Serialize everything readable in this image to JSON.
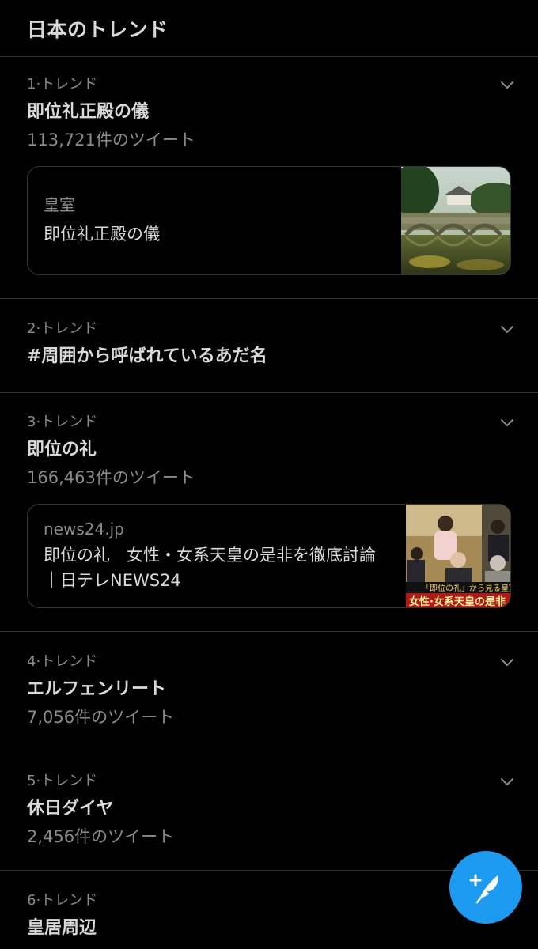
{
  "header": {
    "title": "日本のトレンド"
  },
  "trends": [
    {
      "meta": "1·トレンド",
      "name": "即位礼正殿の儀",
      "count": "113,721件のツイート",
      "card": {
        "source": "皇室",
        "headline": "即位礼正殿の儀",
        "image": "imperial-palace-bridge-photo"
      }
    },
    {
      "meta": "2·トレンド",
      "name": "#周囲から呼ばれているあだ名"
    },
    {
      "meta": "3·トレンド",
      "name": "即位の礼",
      "count": "166,463件のツイート",
      "card": {
        "source": "news24.jp",
        "headline": "即位の礼　女性・女系天皇の是非を徹底討論｜日テレNEWS24",
        "image": "imperial-family-news-screenshot",
        "image_caption_top": "「即位の礼」から見る皇室",
        "image_caption_bottom": "女性·女系天皇の是非"
      }
    },
    {
      "meta": "4·トレンド",
      "name": "エルフェンリート",
      "count": "7,056件のツイート"
    },
    {
      "meta": "5·トレンド",
      "name": "休日ダイヤ",
      "count": "2,456件のツイート"
    },
    {
      "meta": "6·トレンド",
      "name": "皇居周辺"
    }
  ],
  "fab": {
    "icon": "compose-tweet-icon"
  },
  "colors": {
    "background": "#000000",
    "accent": "#1d9bf0",
    "divider": "#2f3336",
    "muted_text": "#8b8b8b",
    "primary_text": "#d9d9d9"
  }
}
